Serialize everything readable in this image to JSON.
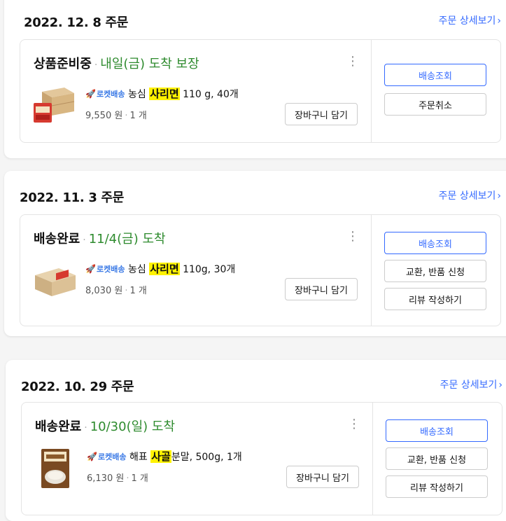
{
  "orders": [
    {
      "date": "2022. 12. 8 주문",
      "detail_link": "주문 상세보기",
      "status": "상품준비중",
      "arrival": "내일(금) 도착 보장",
      "rocket_label": "로켓배송",
      "product_prefix": "농심 ",
      "product_highlight": "사리면",
      "product_suffix": " 110 g, 40개",
      "price": "9,550 원",
      "qty": "1 개",
      "cart_button": "장바구니 담기",
      "actions": [
        "배송조회",
        "주문취소"
      ]
    },
    {
      "date": "2022. 11. 3 주문",
      "detail_link": "주문 상세보기",
      "status": "배송완료",
      "arrival": "11/4(금) 도착",
      "rocket_label": "로켓배송",
      "product_prefix": "농심 ",
      "product_highlight": "사리면",
      "product_suffix": " 110g, 30개",
      "price": "8,030 원",
      "qty": "1 개",
      "cart_button": "장바구니 담기",
      "actions": [
        "배송조회",
        "교환, 반품 신청",
        "리뷰 작성하기"
      ]
    },
    {
      "date": "2022. 10. 29 주문",
      "detail_link": "주문 상세보기",
      "status": "배송완료",
      "arrival": "10/30(일) 도착",
      "rocket_label": "로켓배송",
      "product_prefix": "해표 ",
      "product_highlight": "사골",
      "product_suffix": "분말, 500g, 1개",
      "price": "6,130 원",
      "qty": "1 개",
      "cart_button": "장바구니 담기",
      "actions": [
        "배송조회",
        "교환, 반품 신청",
        "리뷰 작성하기"
      ]
    }
  ],
  "colors": {
    "accent": "#346aff",
    "arrival_green": "#2e8b2e",
    "highlight": "#fff200",
    "rocket": "#3b7ae6"
  },
  "icons": {
    "detail_chevron": "chevron-right-icon",
    "menu": "kebab-menu-icon",
    "rocket": "rocket-icon"
  }
}
